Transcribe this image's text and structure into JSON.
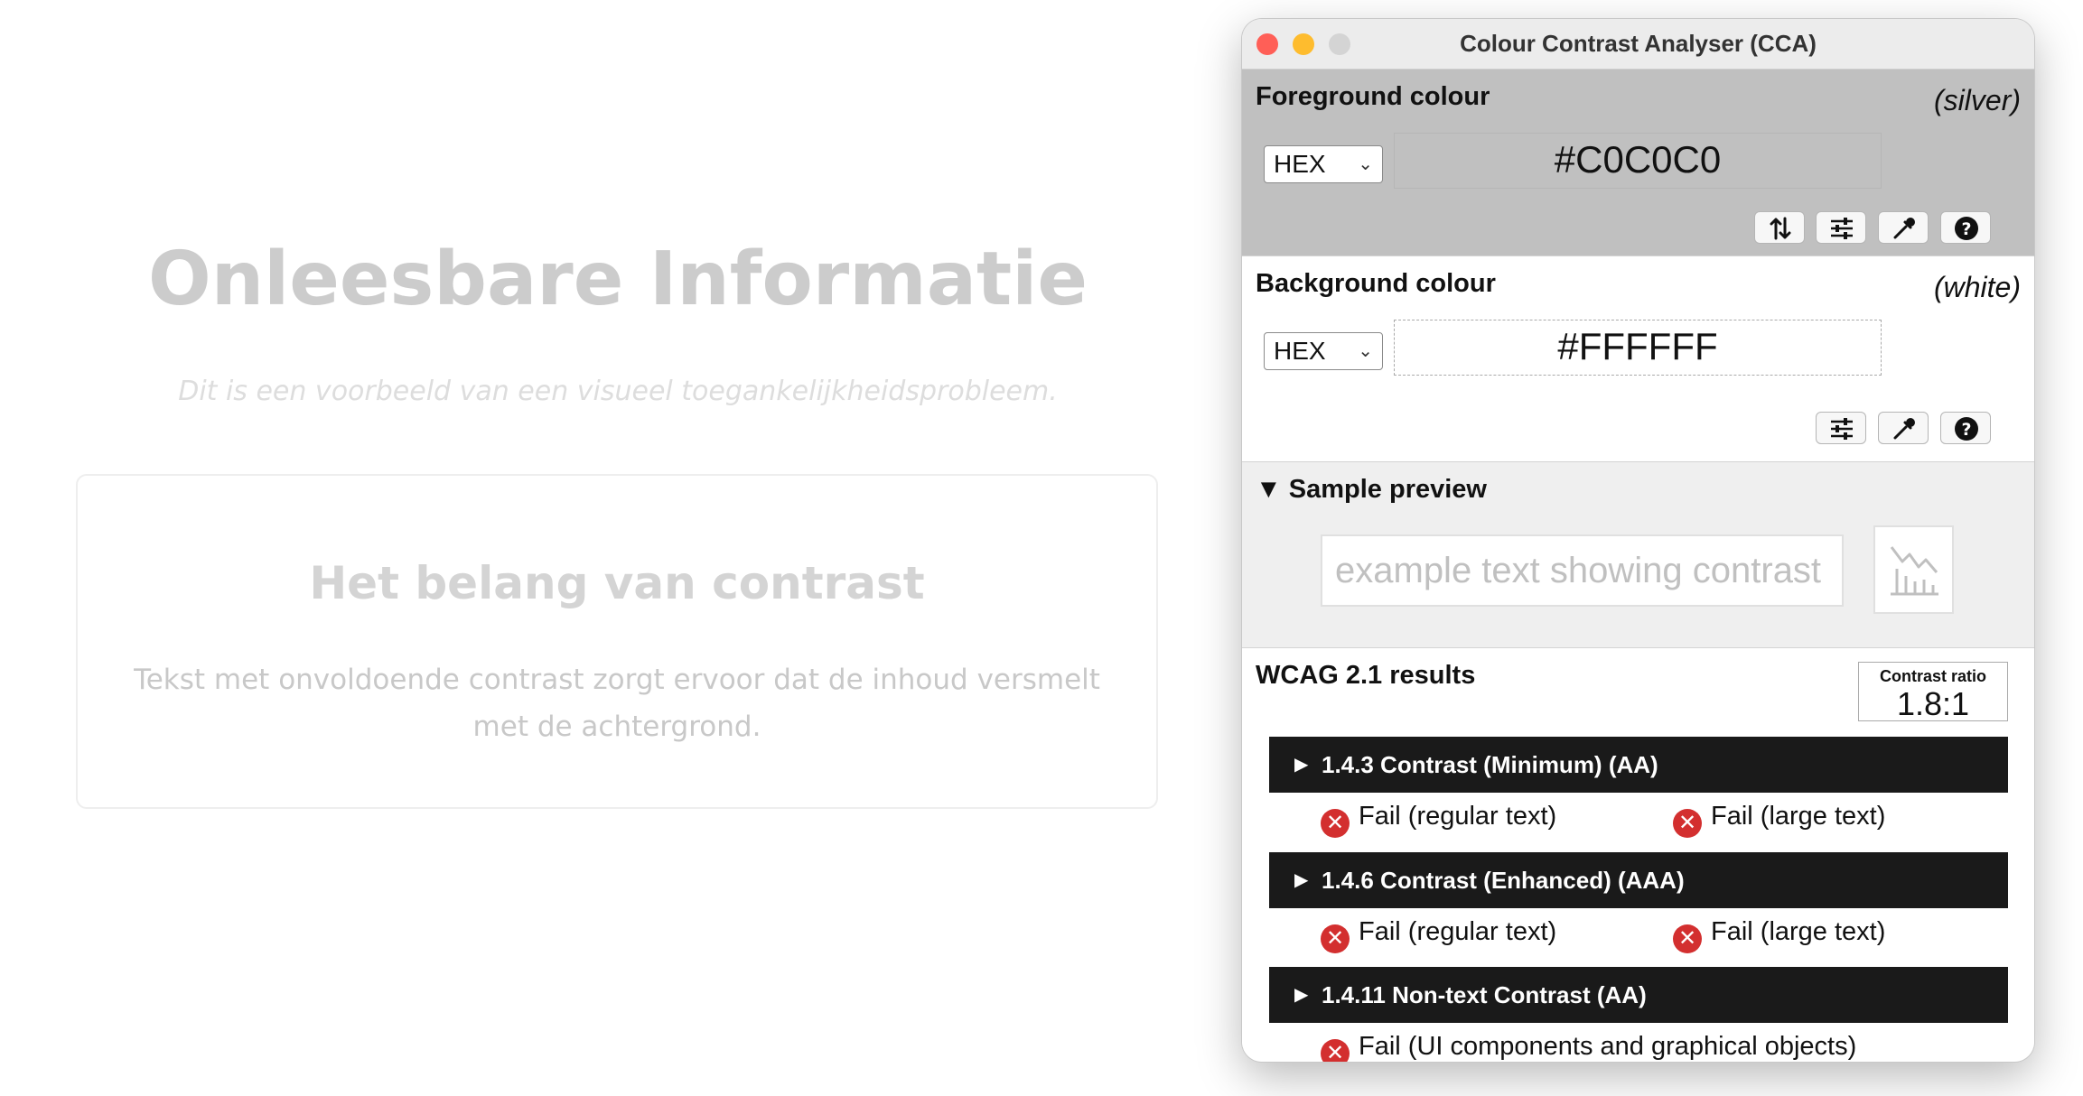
{
  "page": {
    "title": "Onleesbare Informatie",
    "subtitle": "Dit is een voorbeeld van een visueel toegankelijkheidsprobleem.",
    "card": {
      "title": "Het belang van contrast",
      "text": "Tekst met onvoldoende contrast zorgt ervoor dat de inhoud versmelt met de achtergrond."
    }
  },
  "window": {
    "title": "Colour Contrast Analyser (CCA)",
    "foreground": {
      "label": "Foreground colour",
      "name": "(silver)",
      "format": "HEX",
      "value": "#C0C0C0",
      "color": "#C0C0C0"
    },
    "background": {
      "label": "Background colour",
      "name": "(white)",
      "format": "HEX",
      "value": "#FFFFFF",
      "color": "#FFFFFF"
    },
    "sample": {
      "label": "Sample preview",
      "text": "example text showing contrast"
    },
    "results": {
      "title": "WCAG 2.1 results",
      "ratio_label": "Contrast ratio",
      "ratio": "1.8:1",
      "criteria": [
        {
          "label": "1.4.3 Contrast (Minimum) (AA)",
          "results": [
            "Fail (regular text)",
            "Fail (large text)"
          ]
        },
        {
          "label": "1.4.6 Contrast (Enhanced) (AAA)",
          "results": [
            "Fail (regular text)",
            "Fail (large text)"
          ]
        },
        {
          "label": "1.4.11 Non-text Contrast (AA)",
          "results": [
            "Fail (UI components and graphical objects)"
          ]
        }
      ],
      "fail_color": "#D32F2F"
    }
  }
}
